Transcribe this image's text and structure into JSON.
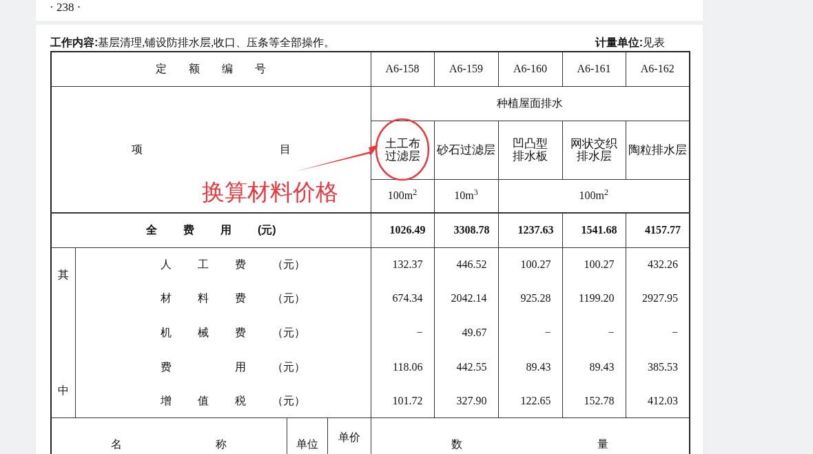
{
  "page_number": "· 238 ·",
  "work_content": {
    "label": "工作内容:",
    "text": "基层清理,铺设防排水层,收口、压条等全部操作。"
  },
  "unit_note": {
    "label": "计量单位:",
    "text": "见表"
  },
  "table": {
    "code_label": "定额编号",
    "codes": [
      "A6-158",
      "A6-159",
      "A6-160",
      "A6-161",
      "A6-162"
    ],
    "item_label": "项目",
    "group": "种植屋面排水",
    "items": [
      [
        "土工布",
        "过滤层"
      ],
      [
        "砂石过滤层"
      ],
      [
        "凹凸型",
        "排水板"
      ],
      [
        "网状交织",
        "排水层"
      ],
      [
        "陶粒排水层"
      ]
    ],
    "units": [
      "100m$^{2}$",
      "10m$^{3}$",
      "100m$^{2}$"
    ],
    "total": {
      "label": "全费用",
      "unit": "(元)",
      "values": [
        "1026.49",
        "3308.78",
        "1237.63",
        "1541.68",
        "4157.77"
      ]
    },
    "breakdown_label": "其中",
    "breakdown": [
      {
        "label": "人工费",
        "unit": "（元）",
        "values": [
          "132.37",
          "446.52",
          "100.27",
          "100.27",
          "432.26"
        ]
      },
      {
        "label": "材料费",
        "unit": "（元）",
        "values": [
          "674.34",
          "2042.14",
          "925.28",
          "1199.20",
          "2927.95"
        ]
      },
      {
        "label": "机械费",
        "unit": "（元）",
        "values": [
          "−",
          "49.67",
          "−",
          "−",
          "−"
        ]
      },
      {
        "label": "费　用",
        "unit": "（元）",
        "values": [
          "118.06",
          "442.55",
          "89.43",
          "89.43",
          "385.53"
        ]
      },
      {
        "label": "增值税",
        "unit": "（元）",
        "values": [
          "101.72",
          "327.90",
          "122.65",
          "152.78",
          "412.03"
        ]
      }
    ],
    "materials_header": {
      "name": "名称",
      "unit": "单位",
      "price": "单价",
      "quantity": "数量"
    }
  },
  "annotation": {
    "text": "换算材料价格"
  }
}
